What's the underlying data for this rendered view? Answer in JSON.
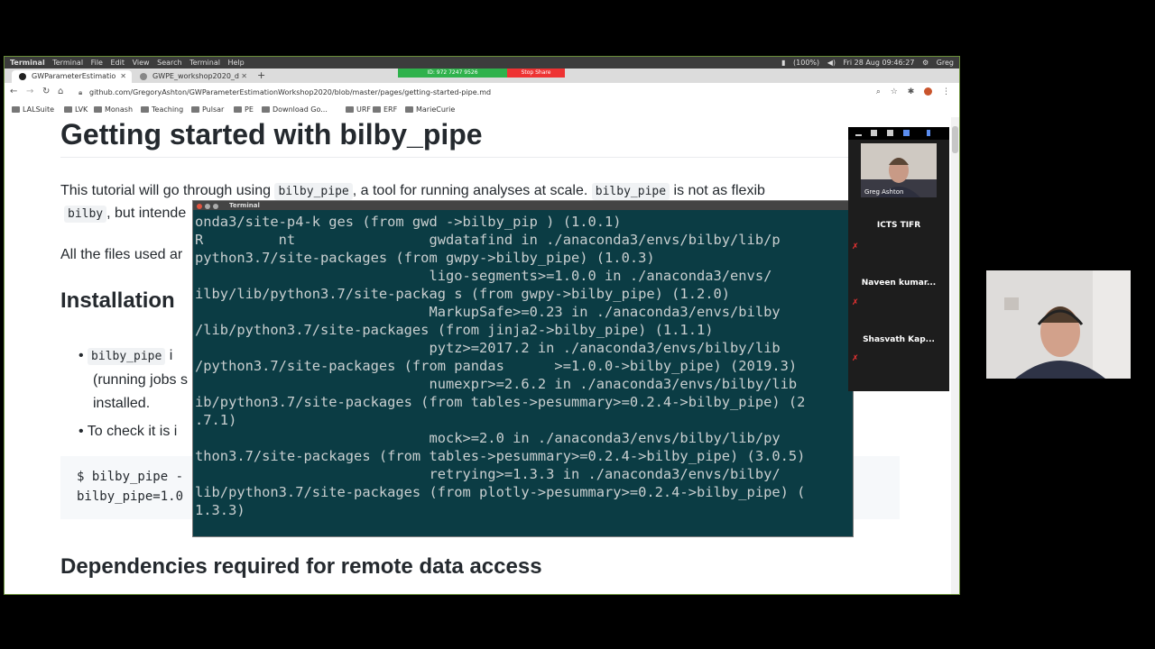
{
  "os_bar": {
    "menus": [
      "Terminal",
      "Terminal",
      "File",
      "Edit",
      "View",
      "Search",
      "Terminal",
      "Help"
    ],
    "battery": "(100%)",
    "clock": "Fri 28 Aug 09:46:27",
    "user": "Greg"
  },
  "browser": {
    "tabs": [
      {
        "label": "GWParameterEstimatio",
        "active": true
      },
      {
        "label": "GWPE_workshop2020_d",
        "active": false
      }
    ],
    "new_tab": "+",
    "share_id": "ID: 972 7247 9526",
    "stop_share": "Stop Share",
    "url": "github.com/GregoryAshton/GWParameterEstimationWorkshop2020/blob/master/pages/getting-started-pipe.md",
    "bookmarks": [
      "LALSuite",
      "LVK",
      "Monash",
      "Teaching",
      "Pulsar",
      "PE",
      "Download Go...",
      "URF",
      "ERF",
      "MarieCurie"
    ]
  },
  "page": {
    "title": "Getting started with bilby_pipe",
    "intro_pre": "This tutorial will go through using ",
    "intro_code1": "bilby_pipe",
    "intro_mid": ", a tool for running analyses at scale. ",
    "intro_code2": "bilby_pipe",
    "intro_post": " is not as flexib",
    "line2_code": "bilby",
    "line2_text": ", but intende",
    "files_text": "All the files used ar",
    "install_heading": "Installation",
    "bullet1_code": "bilby_pipe",
    "bullet1_tail": " i",
    "bullet1_line2": "(running jobs s",
    "bullet1_line3": "installed.",
    "bullet2": "To check it is i",
    "code_line1": "$ bilby_pipe -",
    "code_line2": "bilby_pipe=1.0",
    "deps_heading": "Dependencies required for remote data access"
  },
  "terminal": {
    "title": "Terminal",
    "lines": [
      "onda3/site-p4-k ges (from gwd ->bilby_pip ) (1.0.1)",
      "R         nt                gwdatafind in ./anaconda3/envs/bilby/lib/p",
      "python3.7/site-packages (from gwpy->bilby_pipe) (1.0.3)",
      "                            ligo-segments>=1.0.0 in ./anaconda3/envs/",
      "ilby/lib/python3.7/site-packag s (from gwpy->bilby_pipe) (1.2.0)",
      "                            MarkupSafe>=0.23 in ./anaconda3/envs/bilby",
      "/lib/python3.7/site-packages (from jinja2->bilby_pipe) (1.1.1)",
      "                            pytz>=2017.2 in ./anaconda3/envs/bilby/lib",
      "/python3.7/site-packages (from pandas      >=1.0.0->bilby_pipe) (2019.3)",
      "                            numexpr>=2.6.2 in ./anaconda3/envs/bilby/lib",
      "ib/python3.7/site-packages (from tables->pesummary>=0.2.4->bilby_pipe) (2",
      ".7.1)",
      "                            mock>=2.0 in ./anaconda3/envs/bilby/lib/py",
      "thon3.7/site-packages (from tables->pesummary>=0.2.4->bilby_pipe) (3.0.5)",
      "                            retrying>=1.3.3 in ./anaconda3/envs/bilby/",
      "lib/python3.7/site-packages (from plotly->pesummary>=0.2.4->bilby_pipe) (",
      "1.3.3)"
    ]
  },
  "zoom": {
    "participants": [
      {
        "name": "Greg Ashton",
        "muted": false
      },
      {
        "name": "ICTS TIFR",
        "muted": true
      },
      {
        "name": "Naveen kumar...",
        "muted": true
      },
      {
        "name": "Shasvath Kap...",
        "muted": true
      }
    ]
  }
}
